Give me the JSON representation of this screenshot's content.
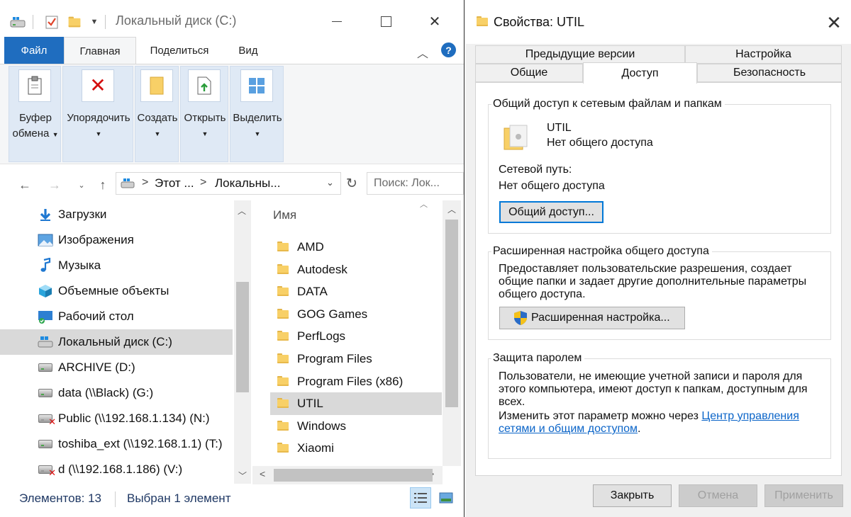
{
  "explorer": {
    "title": "Локальный диск (C:)",
    "ribbon_tabs": {
      "file": "Файл",
      "home": "Главная",
      "share": "Поделиться",
      "view": "Вид"
    },
    "ribbon_groups": [
      {
        "label1": "Буфер",
        "label2": "обмена",
        "icon": "clipboard-icon"
      },
      {
        "label1": "Упорядочить",
        "label2": "",
        "icon": "delete-icon"
      },
      {
        "label1": "Создать",
        "label2": "",
        "icon": "new-folder-icon"
      },
      {
        "label1": "Открыть",
        "label2": "",
        "icon": "open-icon"
      },
      {
        "label1": "Выделить",
        "label2": "",
        "icon": "select-icon"
      }
    ],
    "address": {
      "crumb1": "Этот ...",
      "crumb2": "Локальны..."
    },
    "search": {
      "placeholder": "Поиск: Лок..."
    },
    "nav_items": [
      {
        "label": "Загрузки",
        "icon": "downloads-icon",
        "selected": false
      },
      {
        "label": "Изображения",
        "icon": "pictures-icon",
        "selected": false
      },
      {
        "label": "Музыка",
        "icon": "music-icon",
        "selected": false
      },
      {
        "label": "Объемные объекты",
        "icon": "3d-objects-icon",
        "selected": false
      },
      {
        "label": "Рабочий стол",
        "icon": "desktop-icon",
        "selected": false
      },
      {
        "label": "Локальный диск (C:)",
        "icon": "windows-drive-icon",
        "selected": true
      },
      {
        "label": "ARCHIVE (D:)",
        "icon": "drive-icon",
        "selected": false
      },
      {
        "label": "data (\\\\Black) (G:)",
        "icon": "network-drive-icon",
        "selected": false
      },
      {
        "label": "Public (\\\\192.168.1.134) (N:)",
        "icon": "disconnected-drive-icon",
        "selected": false
      },
      {
        "label": "toshiba_ext (\\\\192.168.1.1) (T:)",
        "icon": "network-drive-icon",
        "selected": false
      },
      {
        "label": "d (\\\\192.168.1.186) (V:)",
        "icon": "disconnected-drive-icon",
        "selected": false
      }
    ],
    "column_header": "Имя",
    "files": [
      {
        "name": "AMD",
        "selected": false
      },
      {
        "name": "Autodesk",
        "selected": false
      },
      {
        "name": "DATA",
        "selected": false
      },
      {
        "name": "GOG Games",
        "selected": false
      },
      {
        "name": "PerfLogs",
        "selected": false
      },
      {
        "name": "Program Files",
        "selected": false
      },
      {
        "name": "Program Files (x86)",
        "selected": false
      },
      {
        "name": "UTIL",
        "selected": true
      },
      {
        "name": "Windows",
        "selected": false
      },
      {
        "name": "Xiaomi",
        "selected": false
      }
    ],
    "status": {
      "items": "Элементов: 13",
      "selected": "Выбран 1 элемент"
    }
  },
  "dialog": {
    "title": "Свойства: UTIL",
    "tabs_row1": [
      "Предыдущие версии",
      "Настройка"
    ],
    "tabs_row2": [
      "Общие",
      "Доступ",
      "Безопасность"
    ],
    "active_tab": "Доступ",
    "network_sharing": {
      "legend": "Общий доступ к сетевым файлам и папкам",
      "folder_name": "UTIL",
      "folder_status": "Нет общего доступа",
      "path_label": "Сетевой путь:",
      "path_value": "Нет общего доступа",
      "button": "Общий доступ..."
    },
    "advanced_sharing": {
      "legend": "Расширенная настройка общего доступа",
      "description": "Предоставляет пользовательские разрешения, создает общие папки и задает другие дополнительные параметры общего доступа.",
      "button": "Расширенная настройка..."
    },
    "password_protection": {
      "legend": "Защита паролем",
      "text1": "Пользователи, не имеющие учетной записи и пароля для этого компьютера, имеют доступ к папкам, доступным для всех.",
      "text2_prefix": "Изменить этот параметр можно через ",
      "link": "Центр управления сетями и общим доступом",
      "text2_suffix": "."
    },
    "buttons": {
      "close": "Закрыть",
      "cancel": "Отмена",
      "apply": "Применить"
    }
  },
  "colors": {
    "accent": "#1f6dbf",
    "selection": "#d9d9d9",
    "link": "#0a64c8"
  }
}
